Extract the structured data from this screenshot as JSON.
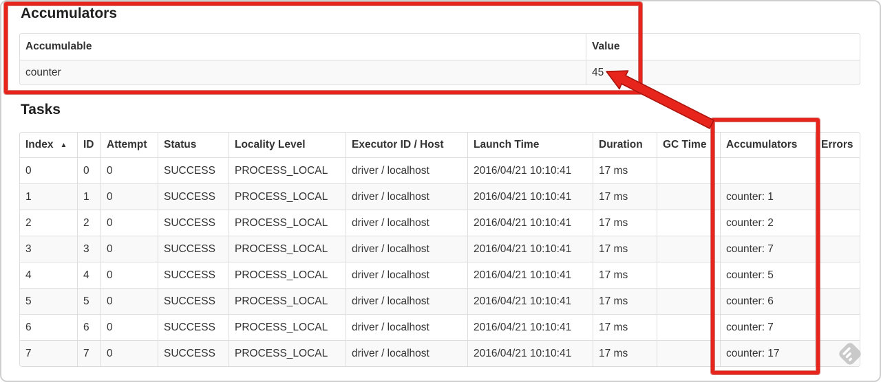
{
  "accumulators_section": {
    "title": "Accumulators",
    "table": {
      "headers": [
        "Accumulable",
        "Value"
      ],
      "rows": [
        [
          "counter",
          "45"
        ]
      ]
    }
  },
  "tasks_section": {
    "title": "Tasks",
    "sort_indicator": "▲",
    "table": {
      "headers": [
        "Index",
        "ID",
        "Attempt",
        "Status",
        "Locality Level",
        "Executor ID / Host",
        "Launch Time",
        "Duration",
        "GC Time",
        "Accumulators",
        "Errors"
      ],
      "rows": [
        [
          "0",
          "0",
          "0",
          "SUCCESS",
          "PROCESS_LOCAL",
          "driver / localhost",
          "2016/04/21 10:10:41",
          "17 ms",
          "",
          "",
          ""
        ],
        [
          "1",
          "1",
          "0",
          "SUCCESS",
          "PROCESS_LOCAL",
          "driver / localhost",
          "2016/04/21 10:10:41",
          "17 ms",
          "",
          "counter: 1",
          ""
        ],
        [
          "2",
          "2",
          "0",
          "SUCCESS",
          "PROCESS_LOCAL",
          "driver / localhost",
          "2016/04/21 10:10:41",
          "17 ms",
          "",
          "counter: 2",
          ""
        ],
        [
          "3",
          "3",
          "0",
          "SUCCESS",
          "PROCESS_LOCAL",
          "driver / localhost",
          "2016/04/21 10:10:41",
          "17 ms",
          "",
          "counter: 7",
          ""
        ],
        [
          "4",
          "4",
          "0",
          "SUCCESS",
          "PROCESS_LOCAL",
          "driver / localhost",
          "2016/04/21 10:10:41",
          "17 ms",
          "",
          "counter: 5",
          ""
        ],
        [
          "5",
          "5",
          "0",
          "SUCCESS",
          "PROCESS_LOCAL",
          "driver / localhost",
          "2016/04/21 10:10:41",
          "17 ms",
          "",
          "counter: 6",
          ""
        ],
        [
          "6",
          "6",
          "0",
          "SUCCESS",
          "PROCESS_LOCAL",
          "driver / localhost",
          "2016/04/21 10:10:41",
          "17 ms",
          "",
          "counter: 7",
          ""
        ],
        [
          "7",
          "7",
          "0",
          "SUCCESS",
          "PROCESS_LOCAL",
          "driver / localhost",
          "2016/04/21 10:10:41",
          "17 ms",
          "",
          "counter: 17",
          ""
        ]
      ]
    }
  },
  "annotations": {
    "red": "#e8251c",
    "red_dark": "#a8140d",
    "highlighted_value": "45",
    "highlighted_column": "Accumulators"
  },
  "watermark": {
    "icon": "feedly-icon",
    "color": "#c9c9c9"
  }
}
